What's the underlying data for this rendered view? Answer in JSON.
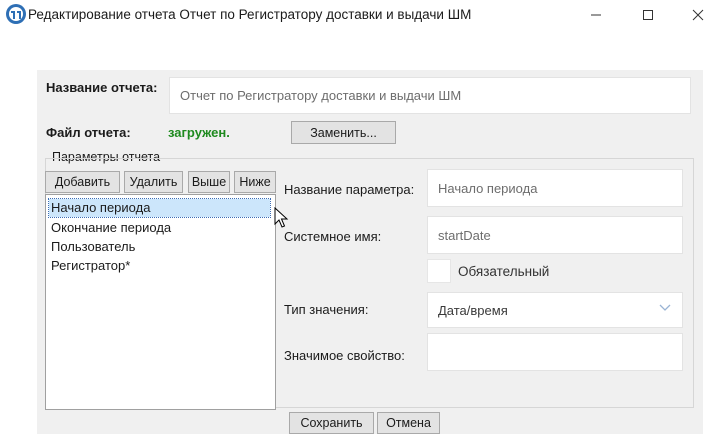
{
  "window": {
    "title": "Редактирование отчета Отчет по Регистратору доставки и выдачи ШМ",
    "icon": "app-logo-icon",
    "controls": [
      "minimize-icon",
      "maximize-icon",
      "close-icon"
    ]
  },
  "report": {
    "name_label": "Название отчета:",
    "name_value": "Отчет по Регистратору доставки и выдачи ШМ",
    "file_label": "Файл отчета:",
    "file_status": "загружен.",
    "file_status_color": "#1e8a1e",
    "replace_button": "Заменить..."
  },
  "params": {
    "group_title": "Параметры отчета",
    "toolbar": {
      "add": "Добавить",
      "delete": "Удалить",
      "up": "Выше",
      "down": "Ниже"
    },
    "list": [
      "Начало периода",
      "Окончание периода",
      "Пользователь",
      "Регистратор*"
    ],
    "selected_index": 0,
    "detail": {
      "name_label": "Название параметра:",
      "name_value": "Начало периода",
      "system_label": "Системное имя:",
      "system_value": "startDate",
      "required_label": "Обязательный",
      "required_checked": false,
      "type_label": "Тип значения:",
      "type_value": "Дата/время",
      "prop_label": "Значимое свойство:",
      "prop_value": ""
    }
  },
  "footer": {
    "save": "Сохранить",
    "cancel": "Отмена"
  },
  "colors": {
    "form_bg": "#f0f0f0",
    "selection_bg": "#cce6fb",
    "dropdown_arrow": "#9ab4d4"
  }
}
